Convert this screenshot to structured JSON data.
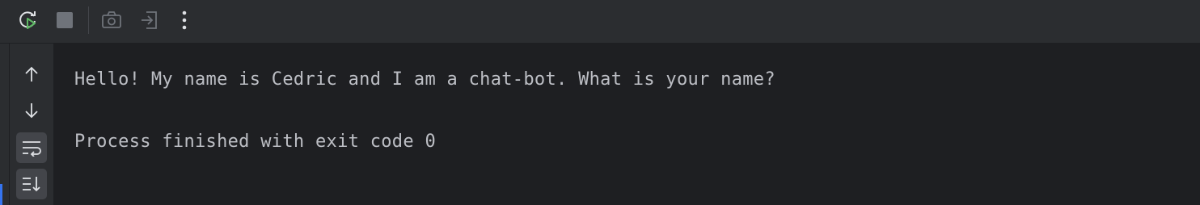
{
  "toolbar": {
    "buttons": [
      {
        "name": "rerun-icon",
        "color": "#5fb865"
      },
      {
        "name": "stop-icon",
        "color": "#6f737a"
      },
      {
        "name": "camera-icon",
        "color": "#6f737a"
      },
      {
        "name": "exit-icon",
        "color": "#6f737a"
      },
      {
        "name": "more-icon",
        "color": "#dfe1e5"
      }
    ]
  },
  "sidebar": {
    "buttons": [
      {
        "name": "scroll-up-icon"
      },
      {
        "name": "scroll-down-icon"
      },
      {
        "name": "soft-wrap-icon",
        "active": true
      },
      {
        "name": "scroll-to-end-icon",
        "active": true
      }
    ]
  },
  "console": {
    "lines": [
      "Hello! My name is Cedric and I am a chat-bot. What is your name?",
      "Process finished with exit code 0"
    ]
  },
  "colors": {
    "toolbar_bg": "#2b2d30",
    "console_bg": "#1e1f22",
    "text": "#bcbec4",
    "accent": "#3574f0",
    "run_green": "#5fb865"
  }
}
